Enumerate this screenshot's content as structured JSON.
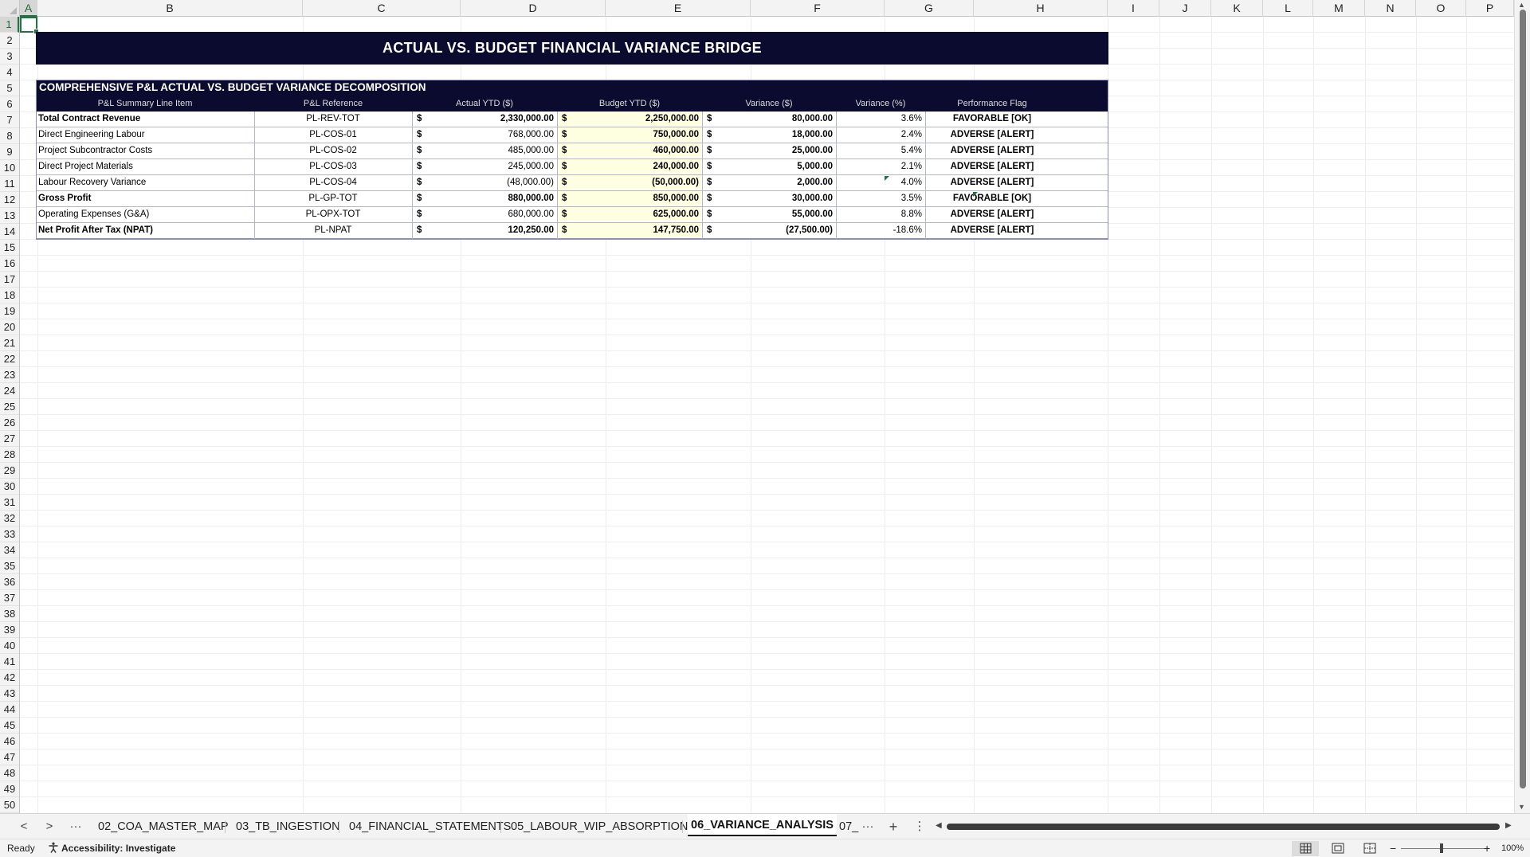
{
  "columns": [
    "A",
    "B",
    "C",
    "D",
    "E",
    "F",
    "G",
    "H",
    "I",
    "J",
    "K",
    "L",
    "M",
    "N",
    "O",
    "P"
  ],
  "selected_cell": {
    "column": "A",
    "row": "1"
  },
  "rows": [
    "1",
    "2",
    "3",
    "4",
    "5",
    "6",
    "7",
    "8",
    "9",
    "10",
    "11",
    "12",
    "13",
    "14",
    "15",
    "16",
    "17",
    "18",
    "19",
    "20",
    "21",
    "22",
    "23",
    "24",
    "25",
    "26",
    "27",
    "28",
    "29",
    "30",
    "31",
    "32",
    "33",
    "34",
    "35",
    "36",
    "37",
    "38",
    "39",
    "40",
    "41",
    "42",
    "43",
    "44",
    "45",
    "46",
    "47",
    "48",
    "49",
    "50"
  ],
  "sheet": {
    "title": "ACTUAL VS. BUDGET FINANCIAL VARIANCE BRIDGE",
    "table_caption": "COMPREHENSIVE P&L ACTUAL VS. BUDGET VARIANCE DECOMPOSITION",
    "headers": [
      "P&L Summary Line Item",
      "P&L Reference",
      "Actual YTD ($)",
      "Budget YTD ($)",
      "Variance ($)",
      "Variance (%)",
      "Performance Flag"
    ],
    "currency_symbol": "$",
    "rows": [
      {
        "item": "Total Contract Revenue",
        "ref": "PL-REV-TOT",
        "actual": "2,330,000.00",
        "budget": "2,250,000.00",
        "variance": "80,000.00",
        "pct": "3.6%",
        "flag": "FAVORABLE [OK]",
        "bold": true
      },
      {
        "item": "Direct Engineering Labour",
        "ref": "PL-COS-01",
        "actual": "768,000.00",
        "budget": "750,000.00",
        "variance": "18,000.00",
        "pct": "2.4%",
        "flag": "ADVERSE [ALERT]",
        "bold": false
      },
      {
        "item": "Project Subcontractor Costs",
        "ref": "PL-COS-02",
        "actual": "485,000.00",
        "budget": "460,000.00",
        "variance": "25,000.00",
        "pct": "5.4%",
        "flag": "ADVERSE [ALERT]",
        "bold": false
      },
      {
        "item": "Direct Project Materials",
        "ref": "PL-COS-03",
        "actual": "245,000.00",
        "budget": "240,000.00",
        "variance": "5,000.00",
        "pct": "2.1%",
        "flag": "ADVERSE [ALERT]",
        "bold": false
      },
      {
        "item": "Labour Recovery Variance",
        "ref": "PL-COS-04",
        "actual": "(48,000.00)",
        "budget": "(50,000.00)",
        "variance": "2,000.00",
        "pct": "4.0%",
        "flag": "ADVERSE [ALERT]",
        "bold": false
      },
      {
        "item": "Gross Profit",
        "ref": "PL-GP-TOT",
        "actual": "880,000.00",
        "budget": "850,000.00",
        "variance": "30,000.00",
        "pct": "3.5%",
        "flag": "FAVORABLE [OK]",
        "bold": true
      },
      {
        "item": "Operating Expenses (G&A)",
        "ref": "PL-OPX-TOT",
        "actual": "680,000.00",
        "budget": "625,000.00",
        "variance": "55,000.00",
        "pct": "8.8%",
        "flag": "ADVERSE [ALERT]",
        "bold": false
      },
      {
        "item": "Net Profit After Tax (NPAT)",
        "ref": "PL-NPAT",
        "actual": "120,250.00",
        "budget": "147,750.00",
        "variance": "(27,500.00)",
        "pct": "-18.6%",
        "flag": "ADVERSE [ALERT]",
        "bold": true
      }
    ]
  },
  "tabs": {
    "more": "···",
    "items": [
      "02_COA_MASTER_MAP",
      "03_TB_INGESTION",
      "04_FINANCIAL_STATEMENTS",
      "05_LABOUR_WIP_ABSORPTION",
      "06_VARIANCE_ANALYSIS",
      "07_"
    ],
    "active": "06_VARIANCE_ANALYSIS",
    "add": "+",
    "options": "⋮"
  },
  "status": {
    "ready": "Ready",
    "accessibility": "Accessibility: Investigate",
    "zoom_minus": "−",
    "zoom_plus": "+",
    "zoom": "100%"
  },
  "colors": {
    "header_navy": "#0b0b2f",
    "budget_fill": "#fefee0",
    "excel_green": "#217346"
  }
}
